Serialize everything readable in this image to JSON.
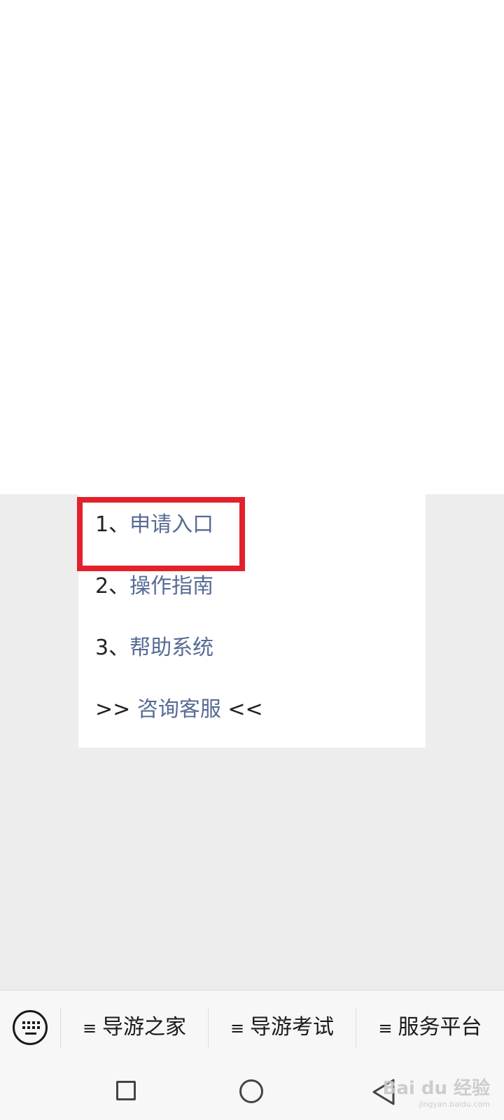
{
  "popup_menu": {
    "items": [
      {
        "num": "1",
        "sep": "、",
        "label": "申请入口"
      },
      {
        "num": "2",
        "sep": "、",
        "label": "操作指南"
      },
      {
        "num": "3",
        "sep": "、",
        "label": "帮助系统"
      }
    ],
    "customer_service": {
      "prefix": ">>",
      "label": "咨询客服",
      "suffix": "<<"
    }
  },
  "menu_bar": {
    "keyboard_icon": "keyboard-icon",
    "buttons": [
      {
        "icon": "≡",
        "label": "导游之家"
      },
      {
        "icon": "≡",
        "label": "导游考试"
      },
      {
        "icon": "≡",
        "label": "服务平台"
      }
    ]
  },
  "nav_bar": {
    "icons": [
      "recent-apps-icon",
      "home-icon",
      "back-icon"
    ]
  },
  "watermark": {
    "text": "Bai du 经验",
    "subtext": "jingyan.baidu.com"
  },
  "colors": {
    "link": "#576b95",
    "highlight": "#e2212d",
    "chat_background": "#ededed",
    "bar_background": "#f7f7f7"
  }
}
